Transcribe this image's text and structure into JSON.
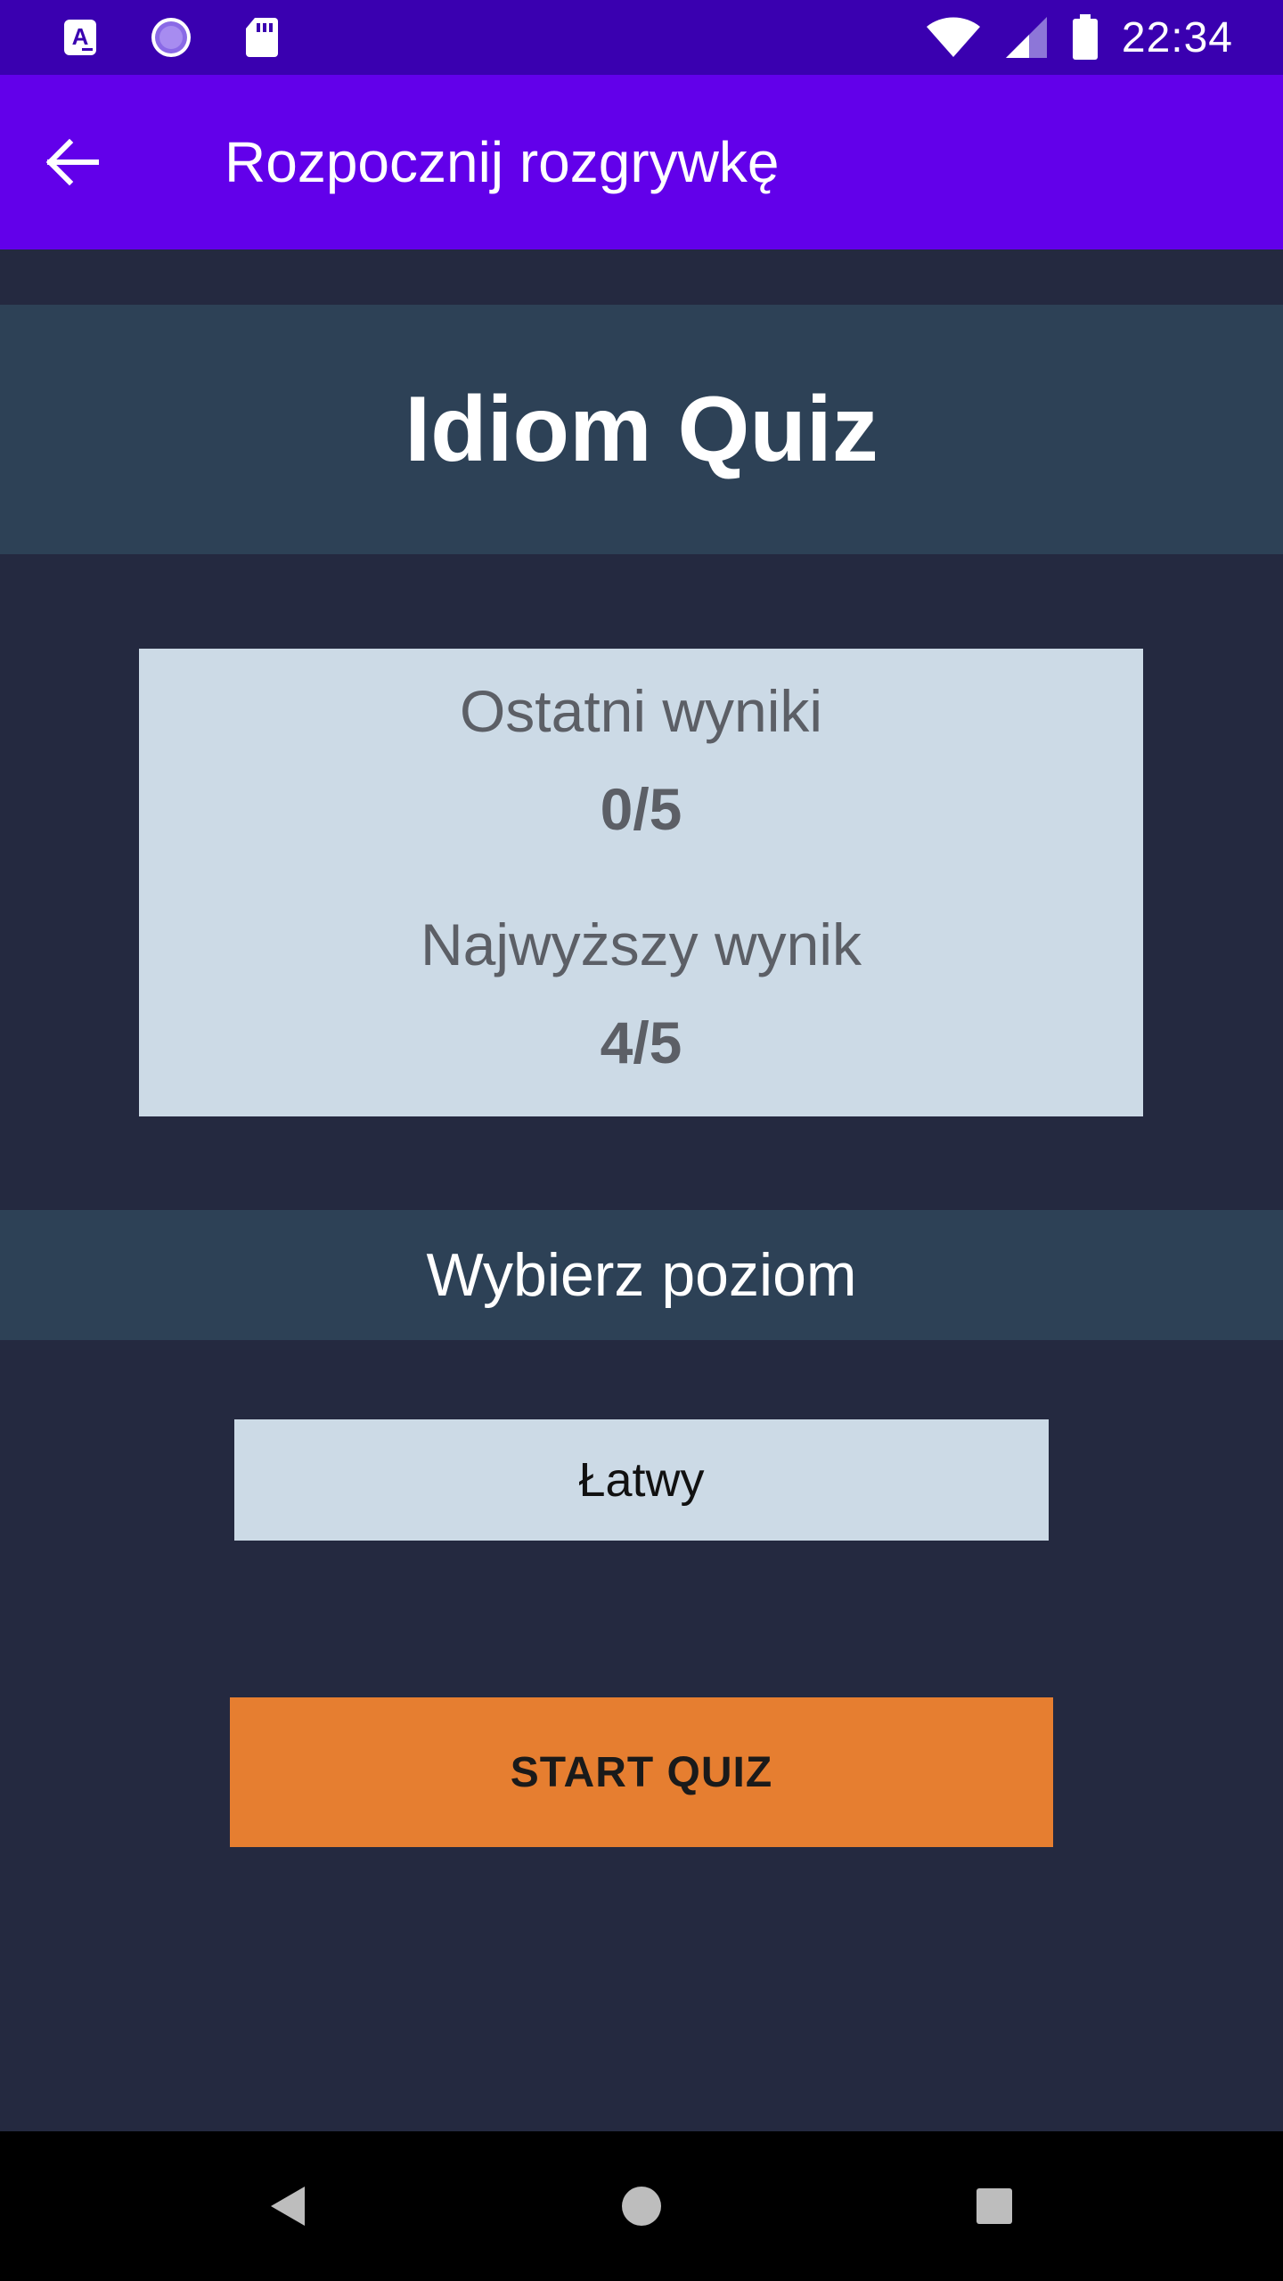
{
  "status_bar": {
    "time": "22:34",
    "left_icons": [
      "a-notification-icon",
      "sync-icon",
      "sd-card-icon"
    ],
    "right_icons": [
      "wifi-icon",
      "signal-icon",
      "battery-icon"
    ],
    "background": "#3a00b0"
  },
  "app_bar": {
    "title": "Rozpocznij rozgrywkę",
    "back_icon": "arrow-back-icon",
    "background": "#6200ea"
  },
  "main": {
    "quiz_title": "Idiom Quiz",
    "scores": {
      "last_label": "Ostatni wyniki",
      "last_value": "0/5",
      "best_label": "Najwyższy wynik",
      "best_value": "4/5"
    },
    "level_heading": "Wybierz poziom",
    "level_selected": "Łatwy",
    "start_button": "START QUIZ"
  },
  "colors": {
    "background": "#242940",
    "band": "#2d4156",
    "card": "#ccdae6",
    "accent": "#e67e30"
  },
  "nav_bar": {
    "icons": [
      "back-triangle-icon",
      "home-circle-icon",
      "recents-square-icon"
    ]
  }
}
